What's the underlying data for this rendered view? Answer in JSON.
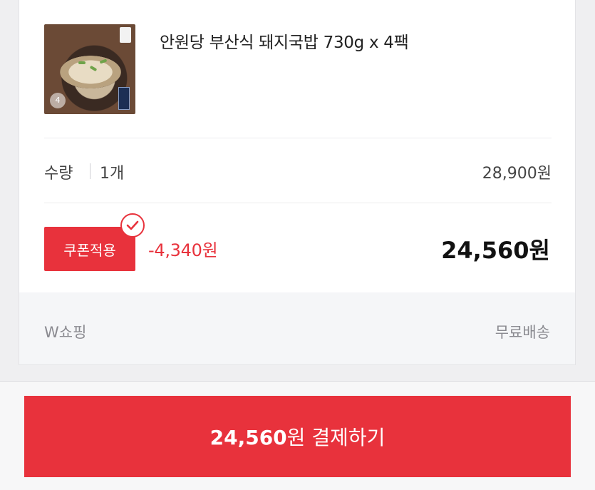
{
  "product": {
    "title": "안원당 부산식 돼지국밥 730g x 4팩",
    "image_badge": "4"
  },
  "quantity": {
    "label": "수량",
    "value": "1개",
    "original_price": "28,900원"
  },
  "coupon": {
    "button_label": "쿠폰적용",
    "discount": "-4,340원",
    "final_price": "24,560원"
  },
  "seller": {
    "name": "W쇼핑",
    "shipping": "무료배송"
  },
  "checkout": {
    "amount": "24,560",
    "rest": "원 결제하기"
  },
  "colors": {
    "accent": "#e8323c",
    "muted_text": "#8a8a90"
  }
}
